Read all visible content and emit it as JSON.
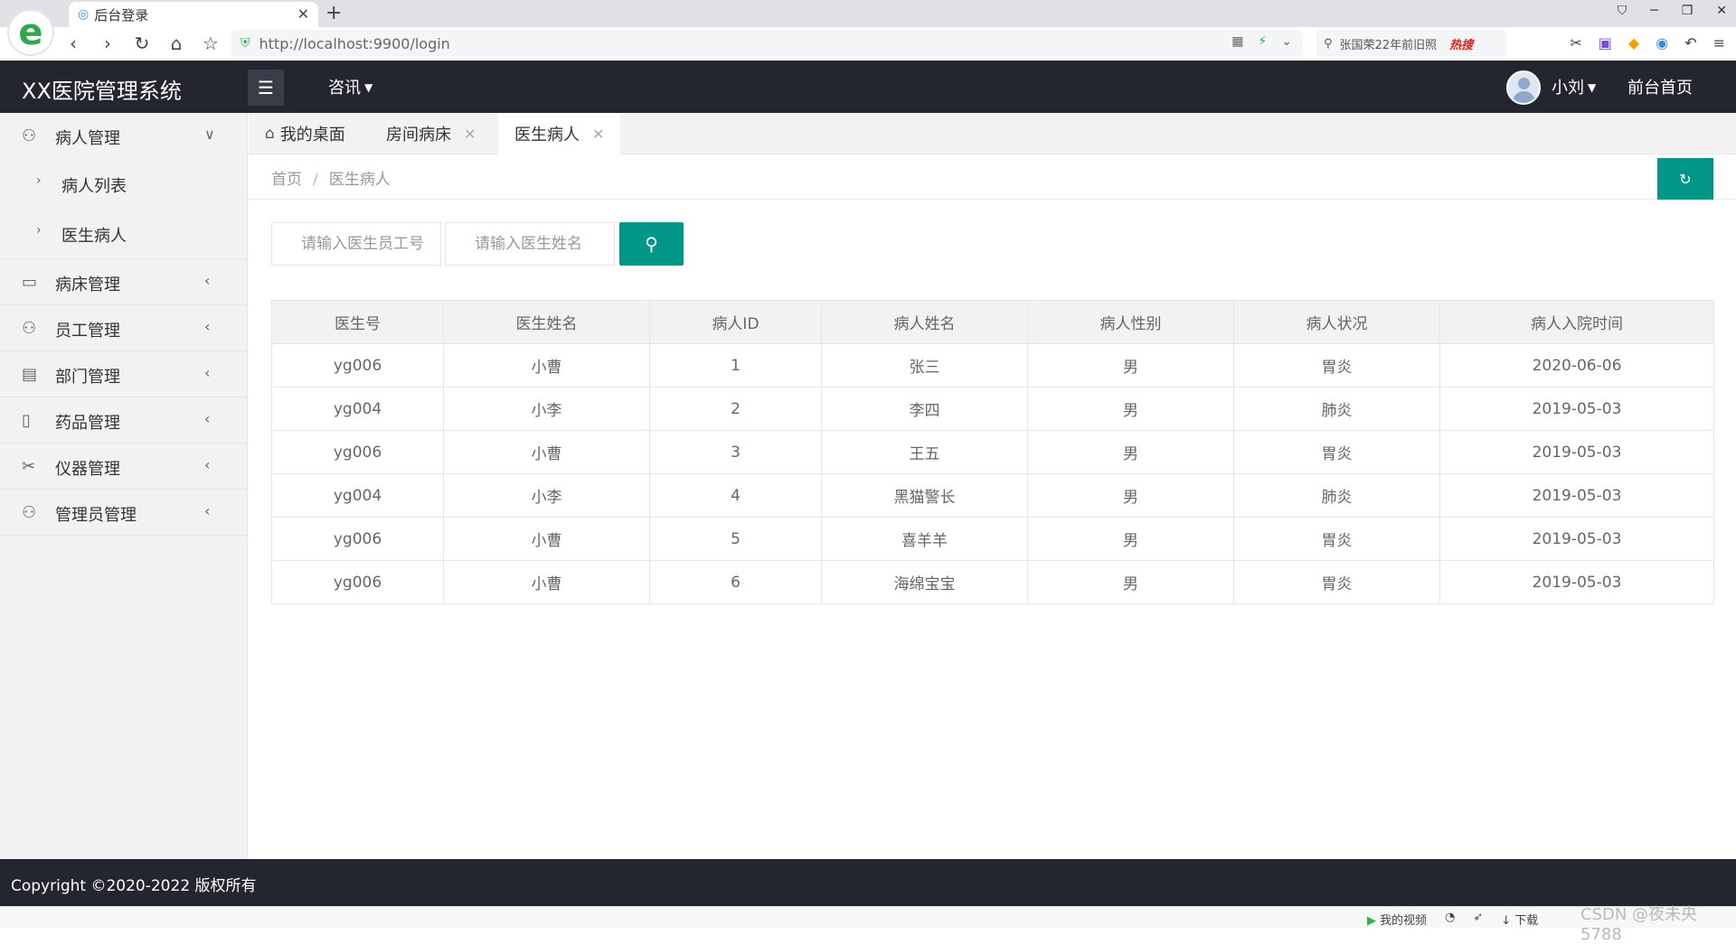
{
  "browser": {
    "tab_title": "后台登录",
    "url": "http://localhost:9900/login",
    "search_text": "张国荣22年前旧照",
    "search_hot": "热搜"
  },
  "header": {
    "logo": "XX医院管理系统",
    "nav_news": "咨讯",
    "user_name": "小刘",
    "front_home": "前台首页"
  },
  "sidebar": {
    "groups": [
      {
        "label": "病人管理",
        "icon": "user-icon",
        "expanded": true,
        "children": [
          {
            "label": "病人列表"
          },
          {
            "label": "医生病人"
          }
        ]
      },
      {
        "label": "病床管理",
        "icon": "bed-icon"
      },
      {
        "label": "员工管理",
        "icon": "staff-icon"
      },
      {
        "label": "部门管理",
        "icon": "department-icon"
      },
      {
        "label": "药品管理",
        "icon": "medicine-icon"
      },
      {
        "label": "仪器管理",
        "icon": "tools-icon"
      },
      {
        "label": "管理员管理",
        "icon": "admin-icon"
      }
    ]
  },
  "tabs": [
    {
      "label": "我的桌面",
      "icon": "home-icon",
      "closable": false
    },
    {
      "label": "房间病床",
      "closable": true
    },
    {
      "label": "医生病人",
      "closable": true,
      "active": true
    }
  ],
  "breadcrumb": {
    "home": "首页",
    "separator": "/",
    "current": "医生病人"
  },
  "search": {
    "doctor_id_placeholder": "请输入医生员工号",
    "doctor_name_placeholder": "请输入医生姓名"
  },
  "table": {
    "headers": [
      "医生号",
      "医生姓名",
      "病人ID",
      "病人姓名",
      "病人性别",
      "病人状况",
      "病人入院时间"
    ],
    "rows": [
      [
        "yg006",
        "小曹",
        "1",
        "张三",
        "男",
        "胃炎",
        "2020-06-06"
      ],
      [
        "yg004",
        "小李",
        "2",
        "李四",
        "男",
        "肺炎",
        "2019-05-03"
      ],
      [
        "yg006",
        "小曹",
        "3",
        "王五",
        "男",
        "胃炎",
        "2019-05-03"
      ],
      [
        "yg004",
        "小李",
        "4",
        "黑猫警长",
        "男",
        "肺炎",
        "2019-05-03"
      ],
      [
        "yg006",
        "小曹",
        "5",
        "喜羊羊",
        "男",
        "胃炎",
        "2019-05-03"
      ],
      [
        "yg006",
        "小曹",
        "6",
        "海绵宝宝",
        "男",
        "胃炎",
        "2019-05-03"
      ]
    ]
  },
  "footer": {
    "copyright": "Copyright ©2020-2022 版权所有"
  },
  "status_bar": {
    "video": "我的视频",
    "download": "下载",
    "watermark": "CSDN @夜未央5788"
  },
  "colors": {
    "header_bg": "#23262e",
    "accent": "#009688",
    "sidebar_bg": "#f2f2f2"
  }
}
